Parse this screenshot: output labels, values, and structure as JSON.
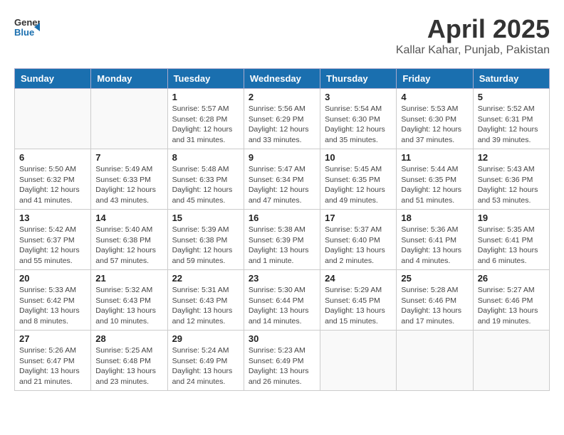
{
  "header": {
    "logo_general": "General",
    "logo_blue": "Blue",
    "title": "April 2025",
    "subtitle": "Kallar Kahar, Punjab, Pakistan"
  },
  "calendar": {
    "days_of_week": [
      "Sunday",
      "Monday",
      "Tuesday",
      "Wednesday",
      "Thursday",
      "Friday",
      "Saturday"
    ],
    "weeks": [
      [
        {
          "day": "",
          "detail": ""
        },
        {
          "day": "",
          "detail": ""
        },
        {
          "day": "1",
          "detail": "Sunrise: 5:57 AM\nSunset: 6:28 PM\nDaylight: 12 hours and 31 minutes."
        },
        {
          "day": "2",
          "detail": "Sunrise: 5:56 AM\nSunset: 6:29 PM\nDaylight: 12 hours and 33 minutes."
        },
        {
          "day": "3",
          "detail": "Sunrise: 5:54 AM\nSunset: 6:30 PM\nDaylight: 12 hours and 35 minutes."
        },
        {
          "day": "4",
          "detail": "Sunrise: 5:53 AM\nSunset: 6:30 PM\nDaylight: 12 hours and 37 minutes."
        },
        {
          "day": "5",
          "detail": "Sunrise: 5:52 AM\nSunset: 6:31 PM\nDaylight: 12 hours and 39 minutes."
        }
      ],
      [
        {
          "day": "6",
          "detail": "Sunrise: 5:50 AM\nSunset: 6:32 PM\nDaylight: 12 hours and 41 minutes."
        },
        {
          "day": "7",
          "detail": "Sunrise: 5:49 AM\nSunset: 6:33 PM\nDaylight: 12 hours and 43 minutes."
        },
        {
          "day": "8",
          "detail": "Sunrise: 5:48 AM\nSunset: 6:33 PM\nDaylight: 12 hours and 45 minutes."
        },
        {
          "day": "9",
          "detail": "Sunrise: 5:47 AM\nSunset: 6:34 PM\nDaylight: 12 hours and 47 minutes."
        },
        {
          "day": "10",
          "detail": "Sunrise: 5:45 AM\nSunset: 6:35 PM\nDaylight: 12 hours and 49 minutes."
        },
        {
          "day": "11",
          "detail": "Sunrise: 5:44 AM\nSunset: 6:35 PM\nDaylight: 12 hours and 51 minutes."
        },
        {
          "day": "12",
          "detail": "Sunrise: 5:43 AM\nSunset: 6:36 PM\nDaylight: 12 hours and 53 minutes."
        }
      ],
      [
        {
          "day": "13",
          "detail": "Sunrise: 5:42 AM\nSunset: 6:37 PM\nDaylight: 12 hours and 55 minutes."
        },
        {
          "day": "14",
          "detail": "Sunrise: 5:40 AM\nSunset: 6:38 PM\nDaylight: 12 hours and 57 minutes."
        },
        {
          "day": "15",
          "detail": "Sunrise: 5:39 AM\nSunset: 6:38 PM\nDaylight: 12 hours and 59 minutes."
        },
        {
          "day": "16",
          "detail": "Sunrise: 5:38 AM\nSunset: 6:39 PM\nDaylight: 13 hours and 1 minute."
        },
        {
          "day": "17",
          "detail": "Sunrise: 5:37 AM\nSunset: 6:40 PM\nDaylight: 13 hours and 2 minutes."
        },
        {
          "day": "18",
          "detail": "Sunrise: 5:36 AM\nSunset: 6:41 PM\nDaylight: 13 hours and 4 minutes."
        },
        {
          "day": "19",
          "detail": "Sunrise: 5:35 AM\nSunset: 6:41 PM\nDaylight: 13 hours and 6 minutes."
        }
      ],
      [
        {
          "day": "20",
          "detail": "Sunrise: 5:33 AM\nSunset: 6:42 PM\nDaylight: 13 hours and 8 minutes."
        },
        {
          "day": "21",
          "detail": "Sunrise: 5:32 AM\nSunset: 6:43 PM\nDaylight: 13 hours and 10 minutes."
        },
        {
          "day": "22",
          "detail": "Sunrise: 5:31 AM\nSunset: 6:43 PM\nDaylight: 13 hours and 12 minutes."
        },
        {
          "day": "23",
          "detail": "Sunrise: 5:30 AM\nSunset: 6:44 PM\nDaylight: 13 hours and 14 minutes."
        },
        {
          "day": "24",
          "detail": "Sunrise: 5:29 AM\nSunset: 6:45 PM\nDaylight: 13 hours and 15 minutes."
        },
        {
          "day": "25",
          "detail": "Sunrise: 5:28 AM\nSunset: 6:46 PM\nDaylight: 13 hours and 17 minutes."
        },
        {
          "day": "26",
          "detail": "Sunrise: 5:27 AM\nSunset: 6:46 PM\nDaylight: 13 hours and 19 minutes."
        }
      ],
      [
        {
          "day": "27",
          "detail": "Sunrise: 5:26 AM\nSunset: 6:47 PM\nDaylight: 13 hours and 21 minutes."
        },
        {
          "day": "28",
          "detail": "Sunrise: 5:25 AM\nSunset: 6:48 PM\nDaylight: 13 hours and 23 minutes."
        },
        {
          "day": "29",
          "detail": "Sunrise: 5:24 AM\nSunset: 6:49 PM\nDaylight: 13 hours and 24 minutes."
        },
        {
          "day": "30",
          "detail": "Sunrise: 5:23 AM\nSunset: 6:49 PM\nDaylight: 13 hours and 26 minutes."
        },
        {
          "day": "",
          "detail": ""
        },
        {
          "day": "",
          "detail": ""
        },
        {
          "day": "",
          "detail": ""
        }
      ]
    ]
  }
}
